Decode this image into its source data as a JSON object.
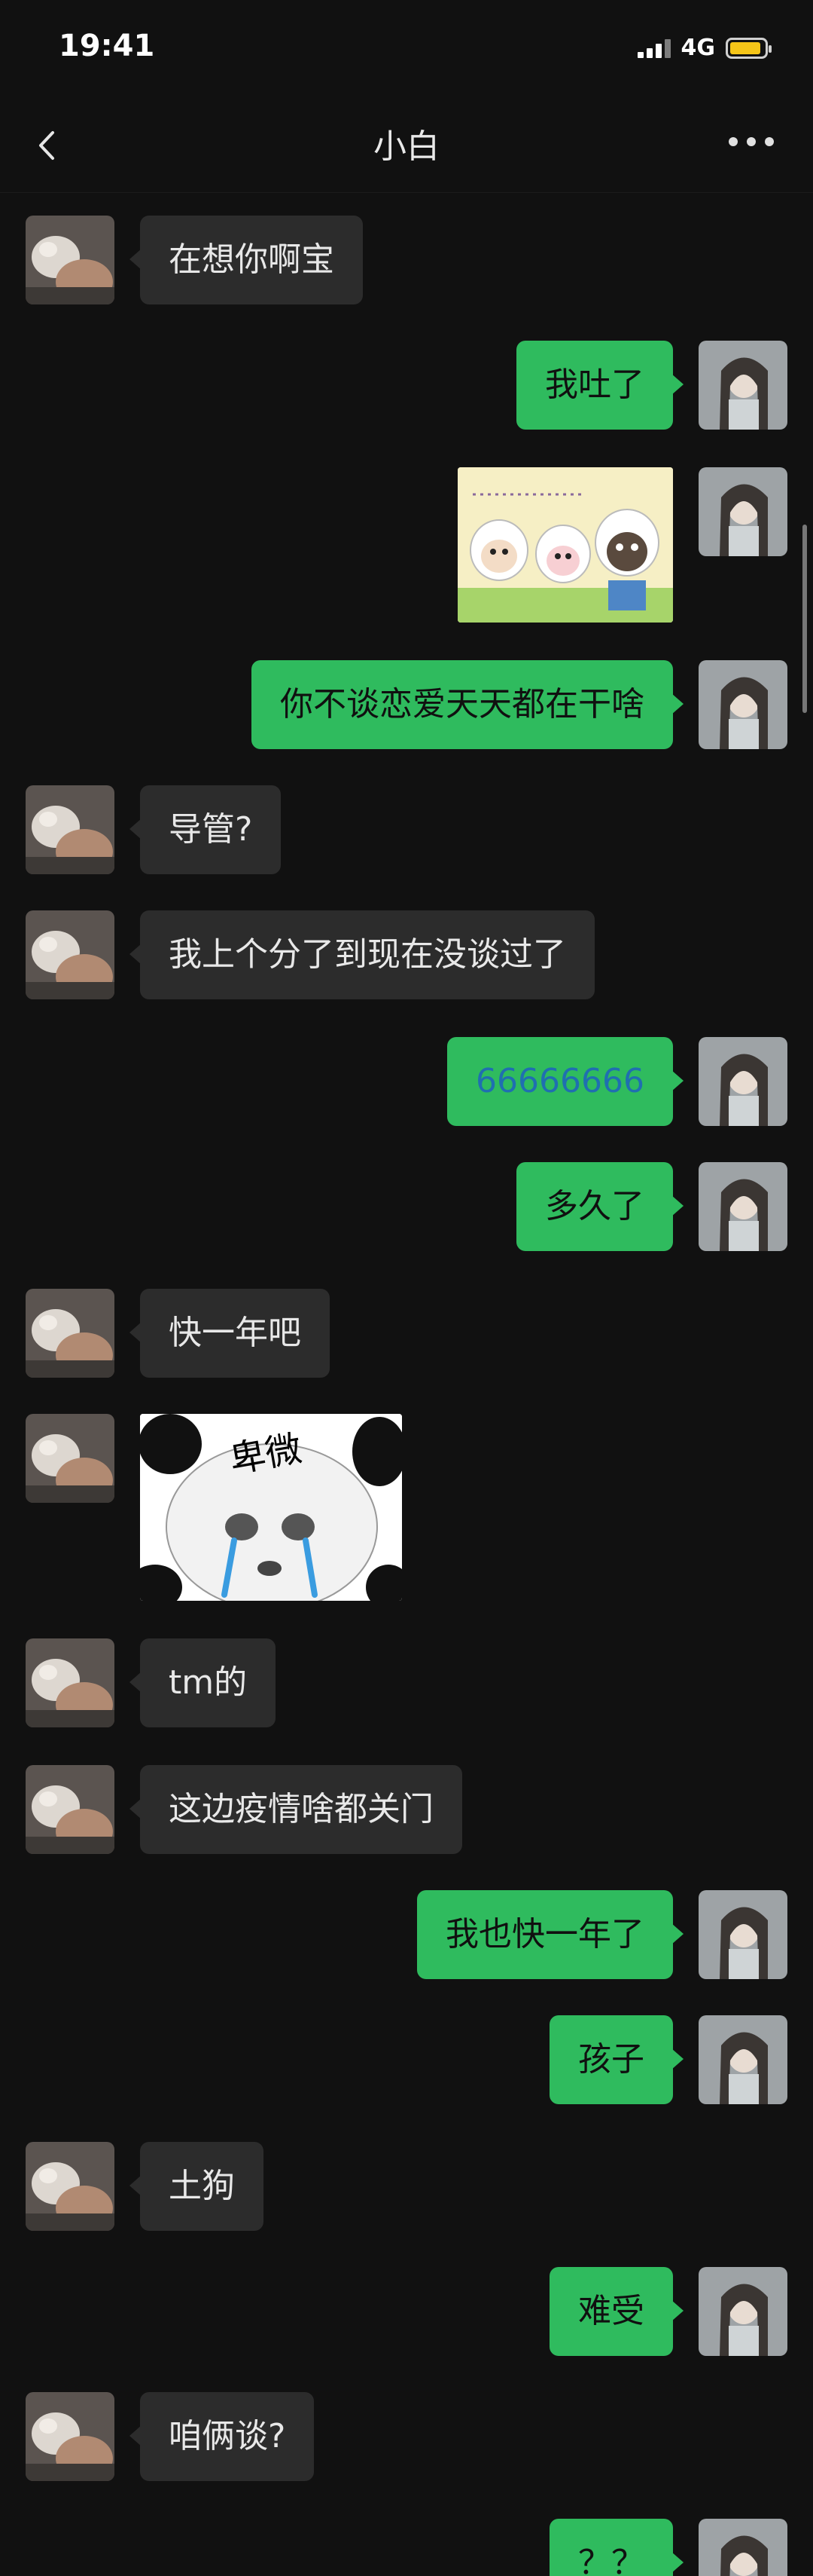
{
  "status": {
    "time": "19:41",
    "network": "4G",
    "colors": {
      "battery": "#f5c518"
    }
  },
  "header": {
    "title": "小白",
    "back_icon": "chevron-left-icon",
    "more_icon": "more-dots-icon"
  },
  "colors": {
    "background": "#111111",
    "incoming_bubble": "#2c2c2c",
    "outgoing_bubble": "#2fbb5e"
  },
  "messages": [
    {
      "side": "left",
      "text": "在想你啊宝"
    },
    {
      "side": "right",
      "text": "我吐了"
    },
    {
      "side": "right",
      "type": "sticker",
      "sticker": "cartoon-sheep-sticker"
    },
    {
      "side": "right",
      "text": "你不谈恋爱天天都在干啥"
    },
    {
      "side": "left",
      "text": "导管?"
    },
    {
      "side": "left",
      "text": "我上个分了到现在没谈过了"
    },
    {
      "side": "right",
      "text": "66666666"
    },
    {
      "side": "right",
      "text": "多久了"
    },
    {
      "side": "left",
      "text": "快一年吧"
    },
    {
      "side": "left",
      "type": "sticker",
      "sticker": "crying-panda-sticker",
      "caption": "卑微"
    },
    {
      "side": "left",
      "text": "tm的"
    },
    {
      "side": "left",
      "text": "这边疫情啥都关门"
    },
    {
      "side": "right",
      "text": "我也快一年了"
    },
    {
      "side": "right",
      "text": "孩子"
    },
    {
      "side": "left",
      "text": "土狗"
    },
    {
      "side": "right",
      "text": "难受"
    },
    {
      "side": "left",
      "text": "咱俩谈?"
    },
    {
      "side": "right",
      "text": "？？"
    }
  ]
}
